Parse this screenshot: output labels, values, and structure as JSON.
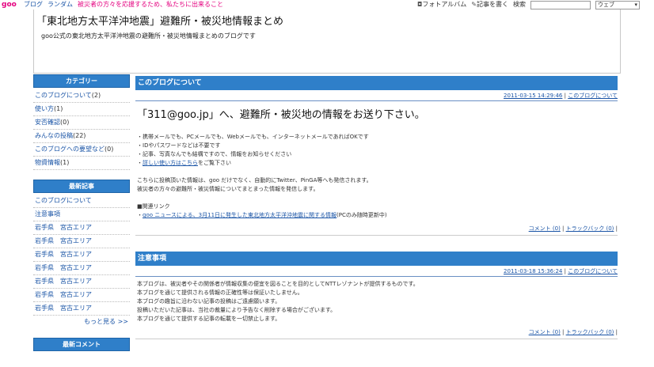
{
  "topbar": {
    "logo": "goo",
    "links": [
      "ブログ",
      "ランダム"
    ],
    "notice": "被災者の方々を応援するため、私たちに出来ること",
    "photo_album": "フォトアルバム",
    "write_article": "記事を書く",
    "search_label": "検索",
    "search_value": "",
    "scope_value": "ウェブ"
  },
  "header": {
    "title": "「東北地方太平洋沖地震」避難所・被災地情報まとめ",
    "subtitle": "goo公式の東北地方太平洋沖地震の避難所・被災地情報まとめのブログです"
  },
  "sidebar": {
    "categories_heading": "カテゴリー",
    "categories": [
      {
        "label": "このブログについて",
        "count": "(2)"
      },
      {
        "label": "使い方",
        "count": "(1)"
      },
      {
        "label": "安否確認",
        "count": "(0)"
      },
      {
        "label": "みんなの投稿",
        "count": "(22)"
      },
      {
        "label": "このブログへの要望など",
        "count": "(0)"
      },
      {
        "label": "物資情報",
        "count": "(1)"
      }
    ],
    "recent_heading": "最新記事",
    "recent": [
      "このブログについて",
      "注意事項",
      "岩手県　宮古エリア",
      "岩手県　宮古エリア",
      "岩手県　宮古エリア",
      "岩手県　宮古エリア",
      "岩手県　宮古エリア",
      "岩手県　宮古エリア",
      "岩手県　宮古エリア"
    ],
    "more": "もっと見る >>",
    "comments_heading": "最新コメント"
  },
  "posts": [
    {
      "heading": "このブログについて",
      "date": "2011-03-15 14:29:46",
      "category": "このブログについて",
      "big": "「311@goo.jp」へ、避難所・被災地の情報をお送り下さい。",
      "lines": [
        "・携帯メールでも、PCメールでも、Webメールでも、インターネットメールであればOKです",
        "・IDやパスワードなどは不要です",
        "・記事、写真なんでも結構ですので、情報をお知らせください"
      ],
      "howto_link": "詳しい使い方はこちら",
      "howto_suffix": "をご覧下さい",
      "para": [
        "こちらに投稿頂いた情報は、goo だけでなく、自動的にTwitter、PinGA等へも発信されます。",
        "被災者の方々の避難所・被災情報についてまとまった情報を発信します。"
      ],
      "related_label": "■関連リンク",
      "related_link": "goo ニュースによる、3月11日に発生した東北地方太平洋沖地震に関する情報",
      "related_suffix": "(PCのみ随時更新中)",
      "comment": "コメント (0)",
      "trackback": "トラックバック (0)"
    },
    {
      "heading": "注意事項",
      "date": "2011-03-18 15:36:24",
      "category": "このブログについて",
      "lines": [
        "本ブログは、被災者やその関係者が情報収集の便宜を図ることを目的としてNTTレゾナントが提供するものです。",
        "本ブログを通じて提供される情報の正確性等は保証いたしません。",
        "本ブログの趣旨に沿わない記事の投稿はご遠慮願います。",
        "投稿いただいた記事は、当社の裁量により予告なく削除する場合がございます。",
        "本ブログを通じて提供する記事の転載を一切禁止します。"
      ],
      "comment": "コメント (0)",
      "trackback": "トラックバック (0)"
    }
  ]
}
